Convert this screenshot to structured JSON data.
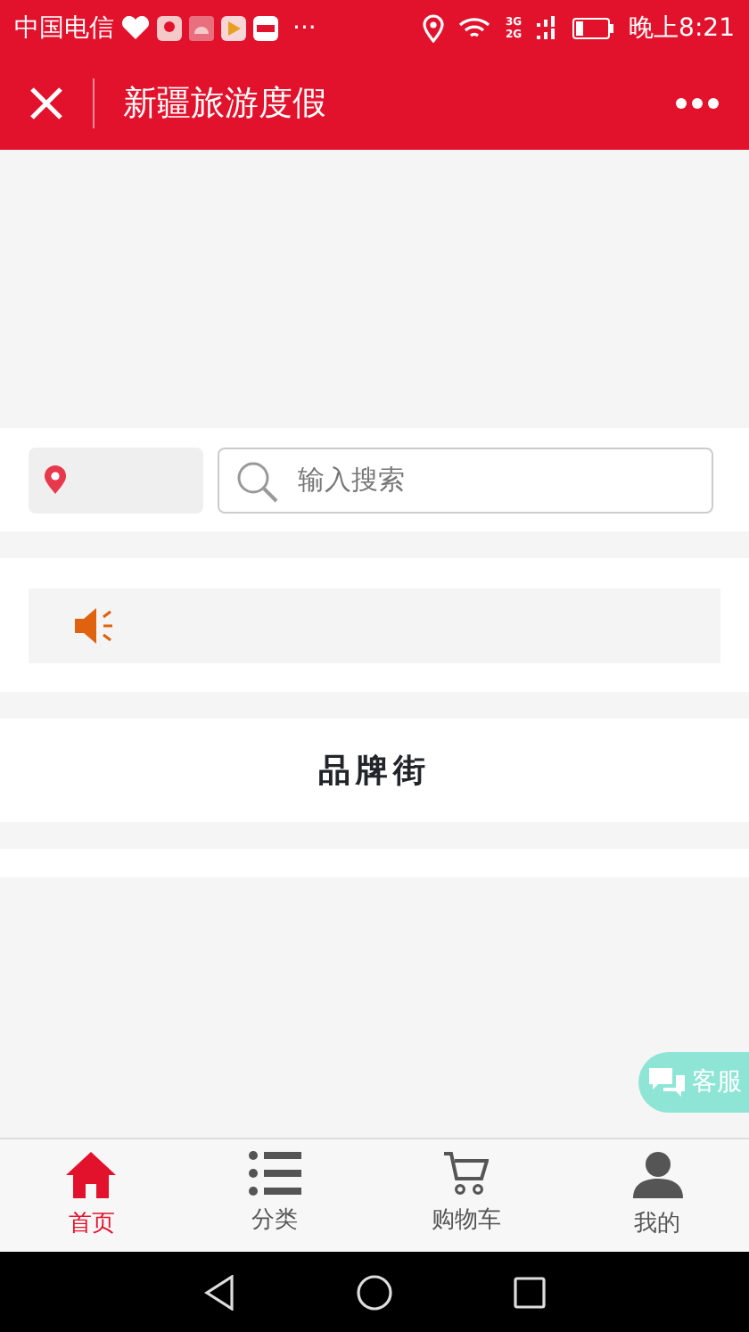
{
  "status_bar": {
    "carrier": "中国电信",
    "more": "···",
    "network_labels": [
      "3G",
      "2G"
    ],
    "time": "晚上8:21"
  },
  "header": {
    "title": "新疆旅游度假"
  },
  "search": {
    "placeholder": "输入搜索"
  },
  "section": {
    "title": "品牌街"
  },
  "customer_service": {
    "label": "客服"
  },
  "tabs": [
    {
      "label": "首页",
      "kind": "home",
      "selected": true
    },
    {
      "label": "分类",
      "kind": "list",
      "selected": false
    },
    {
      "label": "购物车",
      "kind": "cart",
      "selected": false
    },
    {
      "label": "我的",
      "kind": "user",
      "selected": false
    }
  ]
}
